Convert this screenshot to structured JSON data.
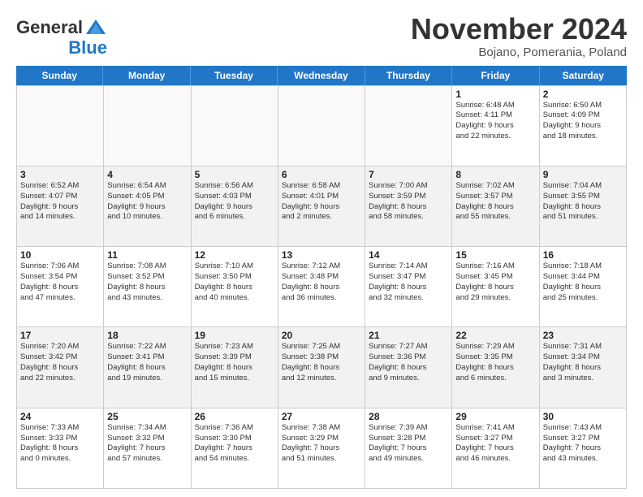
{
  "logo": {
    "general": "General",
    "blue": "Blue"
  },
  "header": {
    "month": "November 2024",
    "location": "Bojano, Pomerania, Poland"
  },
  "weekdays": [
    "Sunday",
    "Monday",
    "Tuesday",
    "Wednesday",
    "Thursday",
    "Friday",
    "Saturday"
  ],
  "weeks": [
    [
      {
        "day": "",
        "info": ""
      },
      {
        "day": "",
        "info": ""
      },
      {
        "day": "",
        "info": ""
      },
      {
        "day": "",
        "info": ""
      },
      {
        "day": "",
        "info": ""
      },
      {
        "day": "1",
        "info": "Sunrise: 6:48 AM\nSunset: 4:11 PM\nDaylight: 9 hours\nand 22 minutes."
      },
      {
        "day": "2",
        "info": "Sunrise: 6:50 AM\nSunset: 4:09 PM\nDaylight: 9 hours\nand 18 minutes."
      }
    ],
    [
      {
        "day": "3",
        "info": "Sunrise: 6:52 AM\nSunset: 4:07 PM\nDaylight: 9 hours\nand 14 minutes."
      },
      {
        "day": "4",
        "info": "Sunrise: 6:54 AM\nSunset: 4:05 PM\nDaylight: 9 hours\nand 10 minutes."
      },
      {
        "day": "5",
        "info": "Sunrise: 6:56 AM\nSunset: 4:03 PM\nDaylight: 9 hours\nand 6 minutes."
      },
      {
        "day": "6",
        "info": "Sunrise: 6:58 AM\nSunset: 4:01 PM\nDaylight: 9 hours\nand 2 minutes."
      },
      {
        "day": "7",
        "info": "Sunrise: 7:00 AM\nSunset: 3:59 PM\nDaylight: 8 hours\nand 58 minutes."
      },
      {
        "day": "8",
        "info": "Sunrise: 7:02 AM\nSunset: 3:57 PM\nDaylight: 8 hours\nand 55 minutes."
      },
      {
        "day": "9",
        "info": "Sunrise: 7:04 AM\nSunset: 3:55 PM\nDaylight: 8 hours\nand 51 minutes."
      }
    ],
    [
      {
        "day": "10",
        "info": "Sunrise: 7:06 AM\nSunset: 3:54 PM\nDaylight: 8 hours\nand 47 minutes."
      },
      {
        "day": "11",
        "info": "Sunrise: 7:08 AM\nSunset: 3:52 PM\nDaylight: 8 hours\nand 43 minutes."
      },
      {
        "day": "12",
        "info": "Sunrise: 7:10 AM\nSunset: 3:50 PM\nDaylight: 8 hours\nand 40 minutes."
      },
      {
        "day": "13",
        "info": "Sunrise: 7:12 AM\nSunset: 3:48 PM\nDaylight: 8 hours\nand 36 minutes."
      },
      {
        "day": "14",
        "info": "Sunrise: 7:14 AM\nSunset: 3:47 PM\nDaylight: 8 hours\nand 32 minutes."
      },
      {
        "day": "15",
        "info": "Sunrise: 7:16 AM\nSunset: 3:45 PM\nDaylight: 8 hours\nand 29 minutes."
      },
      {
        "day": "16",
        "info": "Sunrise: 7:18 AM\nSunset: 3:44 PM\nDaylight: 8 hours\nand 25 minutes."
      }
    ],
    [
      {
        "day": "17",
        "info": "Sunrise: 7:20 AM\nSunset: 3:42 PM\nDaylight: 8 hours\nand 22 minutes."
      },
      {
        "day": "18",
        "info": "Sunrise: 7:22 AM\nSunset: 3:41 PM\nDaylight: 8 hours\nand 19 minutes."
      },
      {
        "day": "19",
        "info": "Sunrise: 7:23 AM\nSunset: 3:39 PM\nDaylight: 8 hours\nand 15 minutes."
      },
      {
        "day": "20",
        "info": "Sunrise: 7:25 AM\nSunset: 3:38 PM\nDaylight: 8 hours\nand 12 minutes."
      },
      {
        "day": "21",
        "info": "Sunrise: 7:27 AM\nSunset: 3:36 PM\nDaylight: 8 hours\nand 9 minutes."
      },
      {
        "day": "22",
        "info": "Sunrise: 7:29 AM\nSunset: 3:35 PM\nDaylight: 8 hours\nand 6 minutes."
      },
      {
        "day": "23",
        "info": "Sunrise: 7:31 AM\nSunset: 3:34 PM\nDaylight: 8 hours\nand 3 minutes."
      }
    ],
    [
      {
        "day": "24",
        "info": "Sunrise: 7:33 AM\nSunset: 3:33 PM\nDaylight: 8 hours\nand 0 minutes."
      },
      {
        "day": "25",
        "info": "Sunrise: 7:34 AM\nSunset: 3:32 PM\nDaylight: 7 hours\nand 57 minutes."
      },
      {
        "day": "26",
        "info": "Sunrise: 7:36 AM\nSunset: 3:30 PM\nDaylight: 7 hours\nand 54 minutes."
      },
      {
        "day": "27",
        "info": "Sunrise: 7:38 AM\nSunset: 3:29 PM\nDaylight: 7 hours\nand 51 minutes."
      },
      {
        "day": "28",
        "info": "Sunrise: 7:39 AM\nSunset: 3:28 PM\nDaylight: 7 hours\nand 49 minutes."
      },
      {
        "day": "29",
        "info": "Sunrise: 7:41 AM\nSunset: 3:27 PM\nDaylight: 7 hours\nand 46 minutes."
      },
      {
        "day": "30",
        "info": "Sunrise: 7:43 AM\nSunset: 3:27 PM\nDaylight: 7 hours\nand 43 minutes."
      }
    ]
  ]
}
